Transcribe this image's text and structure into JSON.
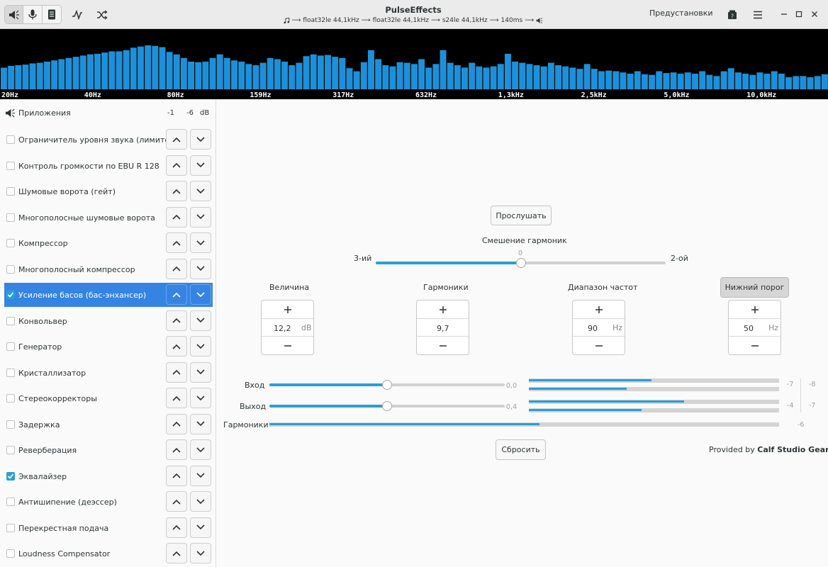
{
  "window": {
    "title": "PulseEffects",
    "pipeline": [
      "float32le 44,1kHz",
      "float32le 44,1kHz",
      "s24le 44,1kHz",
      "140ms"
    ],
    "presets_label": "Предустановки"
  },
  "spectrum": {
    "freq_labels": [
      "20Hz",
      "40Hz",
      "80Hz",
      "159Hz",
      "317Hz",
      "632Hz",
      "1,3kHz",
      "2,5kHz",
      "5,0kHz",
      "10,0kHz"
    ],
    "levels": [
      0.36,
      0.39,
      0.4,
      0.41,
      0.43,
      0.44,
      0.46,
      0.48,
      0.5,
      0.52,
      0.54,
      0.56,
      0.58,
      0.59,
      0.61,
      0.63,
      0.63,
      0.65,
      0.69,
      0.71,
      0.73,
      0.72,
      0.7,
      0.62,
      0.58,
      0.52,
      0.46,
      0.45,
      0.46,
      0.52,
      0.58,
      0.52,
      0.48,
      0.46,
      0.42,
      0.4,
      0.44,
      0.52,
      0.5,
      0.46,
      0.4,
      0.44,
      0.55,
      0.58,
      0.56,
      0.57,
      0.54,
      0.52,
      0.35,
      0.3,
      0.45,
      0.65,
      0.5,
      0.4,
      0.38,
      0.45,
      0.44,
      0.42,
      0.5,
      0.36,
      0.42,
      0.65,
      0.44,
      0.4,
      0.36,
      0.44,
      0.38,
      0.36,
      0.38,
      0.42,
      0.59,
      0.46,
      0.44,
      0.42,
      0.4,
      0.38,
      0.44,
      0.4,
      0.38,
      0.36,
      0.34,
      0.42,
      0.34,
      0.3,
      0.31,
      0.3,
      0.28,
      0.26,
      0.3,
      0.25,
      0.24,
      0.3,
      0.27,
      0.28,
      0.26,
      0.28,
      0.26,
      0.3,
      0.24,
      0.22,
      0.3,
      0.35,
      0.28,
      0.26,
      0.24,
      0.28,
      0.26,
      0.3,
      0.26,
      0.2,
      0.22,
      0.22,
      0.2,
      0.22,
      0.25
    ]
  },
  "sidebar": {
    "apps_label": "Приложения",
    "apps_db": [
      "-1",
      "-6",
      "dB"
    ],
    "plugins": [
      {
        "name": "Ограничитель уровня звука (лимитер)",
        "checked": false,
        "selected": false
      },
      {
        "name": "Контроль громкости по EBU R 128",
        "checked": false,
        "selected": false
      },
      {
        "name": "Шумовые ворота (гейт)",
        "checked": false,
        "selected": false
      },
      {
        "name": "Многополосные шумовые ворота",
        "checked": false,
        "selected": false
      },
      {
        "name": "Компрессор",
        "checked": false,
        "selected": false
      },
      {
        "name": "Многополосный компрессор",
        "checked": false,
        "selected": false
      },
      {
        "name": "Усиление басов (бас-энхансер)",
        "checked": true,
        "selected": true
      },
      {
        "name": "Конвольвер",
        "checked": false,
        "selected": false
      },
      {
        "name": "Генератор",
        "checked": false,
        "selected": false
      },
      {
        "name": "Кристаллизатор",
        "checked": false,
        "selected": false
      },
      {
        "name": "Стереокорректоры",
        "checked": false,
        "selected": false
      },
      {
        "name": "Задержка",
        "checked": false,
        "selected": false
      },
      {
        "name": "Реверберация",
        "checked": false,
        "selected": false
      },
      {
        "name": "Эквалайзер",
        "checked": true,
        "selected": false
      },
      {
        "name": "Антишипение (деэссер)",
        "checked": false,
        "selected": false
      },
      {
        "name": "Перекрестная подача",
        "checked": false,
        "selected": false
      },
      {
        "name": "Loudness Compensator",
        "checked": false,
        "selected": false
      }
    ]
  },
  "main": {
    "listen_label": "Прослушать",
    "blend": {
      "label": "Смешение гармоник",
      "value": "0",
      "left_label": "3-ий",
      "right_label": "2-ой",
      "fraction": 0.5
    },
    "controls": [
      {
        "title": "Величина",
        "value": "12,2",
        "unit": "dB"
      },
      {
        "title": "Гармоники",
        "value": "9,7",
        "unit": ""
      },
      {
        "title": "Диапазон частот",
        "value": "90",
        "unit": "Hz"
      },
      {
        "title": "Нижний порог",
        "value": "50",
        "unit": "Hz"
      }
    ],
    "input": {
      "label": "Вход",
      "value": "0,0",
      "fraction": 0.5,
      "meters": [
        0.49,
        0.39
      ],
      "db": [
        "-7",
        "-8"
      ]
    },
    "output": {
      "label": "Выход",
      "value": "0,4",
      "fraction": 0.5,
      "meters": [
        0.62,
        0.45
      ],
      "db": [
        "-4",
        "-7"
      ]
    },
    "harmonics": {
      "label": "Гармоники",
      "fraction": 0.53,
      "db": "-6"
    },
    "reset_label": "Сбросить",
    "provided_by": "Provided by",
    "provider": "Calf Studio Gears"
  },
  "colors": {
    "accent": "#2a9fd6",
    "selection": "#3584e4",
    "spectrum_bar": "#1e90d8"
  }
}
